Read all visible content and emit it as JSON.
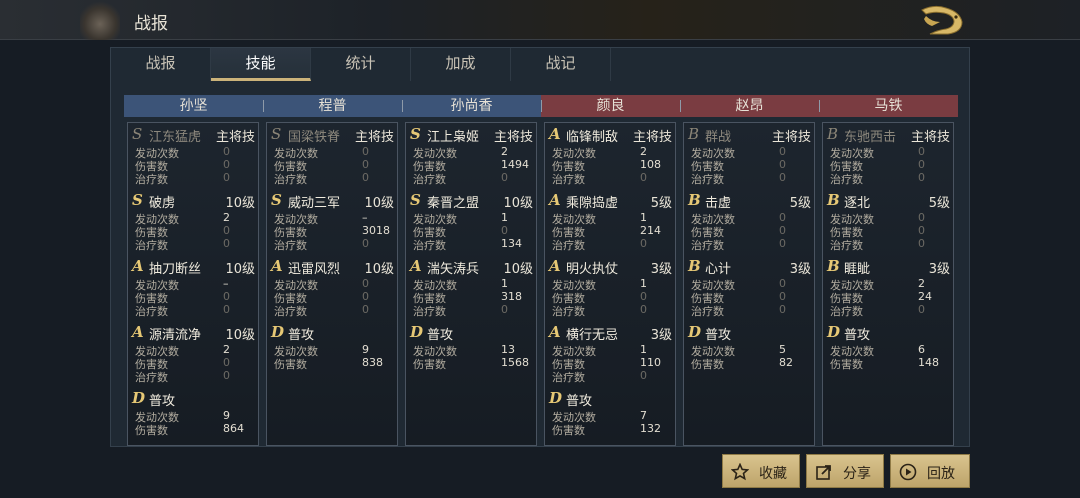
{
  "window": {
    "title": "战报"
  },
  "tabs": [
    {
      "label": "战报",
      "active": false
    },
    {
      "label": "技能",
      "active": true
    },
    {
      "label": "统计",
      "active": false
    },
    {
      "label": "加成",
      "active": false
    },
    {
      "label": "战记",
      "active": false
    }
  ],
  "colors": {
    "ally_header": "#3c5478",
    "enemy_header": "#7a3c41",
    "accent_gold": "#cbb37a",
    "grade_gold": "#e6c875"
  },
  "generals": [
    {
      "name": "孙坚",
      "side": "ally",
      "skills": [
        {
          "grade": "S",
          "name": "江东猛虎",
          "level": "主将技",
          "dim": true,
          "stats": [
            {
              "label": "发动次数",
              "value": "0"
            },
            {
              "label": "伤害数",
              "value": "0"
            },
            {
              "label": "治疗数",
              "value": "0"
            }
          ]
        },
        {
          "grade": "S",
          "name": "破虏",
          "level": "10级",
          "dim": false,
          "stats": [
            {
              "label": "发动次数",
              "value": "2"
            },
            {
              "label": "伤害数",
              "value": "0"
            },
            {
              "label": "治疗数",
              "value": "0"
            }
          ]
        },
        {
          "grade": "A",
          "name": "抽刀断丝",
          "level": "10级",
          "dim": false,
          "stats": [
            {
              "label": "发动次数",
              "value": "–"
            },
            {
              "label": "伤害数",
              "value": "0"
            },
            {
              "label": "治疗数",
              "value": "0"
            }
          ]
        },
        {
          "grade": "A",
          "name": "源清流净",
          "level": "10级",
          "dim": false,
          "stats": [
            {
              "label": "发动次数",
              "value": "2"
            },
            {
              "label": "伤害数",
              "value": "0"
            },
            {
              "label": "治疗数",
              "value": "0"
            }
          ]
        },
        {
          "grade": "D",
          "name": "普攻",
          "level": "",
          "dim": false,
          "stats": [
            {
              "label": "发动次数",
              "value": "9"
            },
            {
              "label": "伤害数",
              "value": "864"
            }
          ]
        }
      ]
    },
    {
      "name": "程普",
      "side": "ally",
      "skills": [
        {
          "grade": "S",
          "name": "国梁铁脊",
          "level": "主将技",
          "dim": true,
          "stats": [
            {
              "label": "发动次数",
              "value": "0"
            },
            {
              "label": "伤害数",
              "value": "0"
            },
            {
              "label": "治疗数",
              "value": "0"
            }
          ]
        },
        {
          "grade": "S",
          "name": "威动三军",
          "level": "10级",
          "dim": false,
          "stats": [
            {
              "label": "发动次数",
              "value": "–"
            },
            {
              "label": "伤害数",
              "value": "3018"
            },
            {
              "label": "治疗数",
              "value": "0"
            }
          ]
        },
        {
          "grade": "A",
          "name": "迅雷风烈",
          "level": "10级",
          "dim": false,
          "stats": [
            {
              "label": "发动次数",
              "value": "0"
            },
            {
              "label": "伤害数",
              "value": "0"
            },
            {
              "label": "治疗数",
              "value": "0"
            }
          ]
        },
        {
          "grade": "D",
          "name": "普攻",
          "level": "",
          "dim": false,
          "stats": [
            {
              "label": "发动次数",
              "value": "9"
            },
            {
              "label": "伤害数",
              "value": "838"
            }
          ]
        }
      ]
    },
    {
      "name": "孙尚香",
      "side": "ally",
      "skills": [
        {
          "grade": "S",
          "name": "江上枭姬",
          "level": "主将技",
          "dim": false,
          "stats": [
            {
              "label": "发动次数",
              "value": "2"
            },
            {
              "label": "伤害数",
              "value": "1494"
            },
            {
              "label": "治疗数",
              "value": "0"
            }
          ]
        },
        {
          "grade": "S",
          "name": "秦晋之盟",
          "level": "10级",
          "dim": false,
          "stats": [
            {
              "label": "发动次数",
              "value": "1"
            },
            {
              "label": "伤害数",
              "value": "0"
            },
            {
              "label": "治疗数",
              "value": "134"
            }
          ]
        },
        {
          "grade": "A",
          "name": "湍矢涛兵",
          "level": "10级",
          "dim": false,
          "stats": [
            {
              "label": "发动次数",
              "value": "1"
            },
            {
              "label": "伤害数",
              "value": "318"
            },
            {
              "label": "治疗数",
              "value": "0"
            }
          ]
        },
        {
          "grade": "D",
          "name": "普攻",
          "level": "",
          "dim": false,
          "stats": [
            {
              "label": "发动次数",
              "value": "13"
            },
            {
              "label": "伤害数",
              "value": "1568"
            }
          ]
        }
      ]
    },
    {
      "name": "颜良",
      "side": "enemy",
      "skills": [
        {
          "grade": "A",
          "name": "临锋制敌",
          "level": "主将技",
          "dim": false,
          "stats": [
            {
              "label": "发动次数",
              "value": "2"
            },
            {
              "label": "伤害数",
              "value": "108"
            },
            {
              "label": "治疗数",
              "value": "0"
            }
          ]
        },
        {
          "grade": "A",
          "name": "乘隙捣虚",
          "level": "5级",
          "dim": false,
          "stats": [
            {
              "label": "发动次数",
              "value": "1"
            },
            {
              "label": "伤害数",
              "value": "214"
            },
            {
              "label": "治疗数",
              "value": "0"
            }
          ]
        },
        {
          "grade": "A",
          "name": "明火执仗",
          "level": "3级",
          "dim": false,
          "stats": [
            {
              "label": "发动次数",
              "value": "1"
            },
            {
              "label": "伤害数",
              "value": "0"
            },
            {
              "label": "治疗数",
              "value": "0"
            }
          ]
        },
        {
          "grade": "A",
          "name": "横行无忌",
          "level": "3级",
          "dim": false,
          "stats": [
            {
              "label": "发动次数",
              "value": "1"
            },
            {
              "label": "伤害数",
              "value": "110"
            },
            {
              "label": "治疗数",
              "value": "0"
            }
          ]
        },
        {
          "grade": "D",
          "name": "普攻",
          "level": "",
          "dim": false,
          "stats": [
            {
              "label": "发动次数",
              "value": "7"
            },
            {
              "label": "伤害数",
              "value": "132"
            }
          ]
        }
      ]
    },
    {
      "name": "赵昂",
      "side": "enemy",
      "skills": [
        {
          "grade": "B",
          "name": "群战",
          "level": "主将技",
          "dim": true,
          "stats": [
            {
              "label": "发动次数",
              "value": "0"
            },
            {
              "label": "伤害数",
              "value": "0"
            },
            {
              "label": "治疗数",
              "value": "0"
            }
          ]
        },
        {
          "grade": "B",
          "name": "击虚",
          "level": "5级",
          "dim": false,
          "stats": [
            {
              "label": "发动次数",
              "value": "0"
            },
            {
              "label": "伤害数",
              "value": "0"
            },
            {
              "label": "治疗数",
              "value": "0"
            }
          ]
        },
        {
          "grade": "B",
          "name": "心计",
          "level": "3级",
          "dim": false,
          "stats": [
            {
              "label": "发动次数",
              "value": "0"
            },
            {
              "label": "伤害数",
              "value": "0"
            },
            {
              "label": "治疗数",
              "value": "0"
            }
          ]
        },
        {
          "grade": "D",
          "name": "普攻",
          "level": "",
          "dim": false,
          "stats": [
            {
              "label": "发动次数",
              "value": "5"
            },
            {
              "label": "伤害数",
              "value": "82"
            }
          ]
        }
      ]
    },
    {
      "name": "马铁",
      "side": "enemy",
      "skills": [
        {
          "grade": "B",
          "name": "东驰西击",
          "level": "主将技",
          "dim": true,
          "stats": [
            {
              "label": "发动次数",
              "value": "0"
            },
            {
              "label": "伤害数",
              "value": "0"
            },
            {
              "label": "治疗数",
              "value": "0"
            }
          ]
        },
        {
          "grade": "B",
          "name": "逐北",
          "level": "5级",
          "dim": false,
          "stats": [
            {
              "label": "发动次数",
              "value": "0"
            },
            {
              "label": "伤害数",
              "value": "0"
            },
            {
              "label": "治疗数",
              "value": "0"
            }
          ]
        },
        {
          "grade": "B",
          "name": "睚眦",
          "level": "3级",
          "dim": false,
          "stats": [
            {
              "label": "发动次数",
              "value": "2"
            },
            {
              "label": "伤害数",
              "value": "24"
            },
            {
              "label": "治疗数",
              "value": "0"
            }
          ]
        },
        {
          "grade": "D",
          "name": "普攻",
          "level": "",
          "dim": false,
          "stats": [
            {
              "label": "发动次数",
              "value": "6"
            },
            {
              "label": "伤害数",
              "value": "148"
            }
          ]
        }
      ]
    }
  ],
  "buttons": [
    {
      "label": "收藏",
      "icon": "star-icon"
    },
    {
      "label": "分享",
      "icon": "share-icon"
    },
    {
      "label": "回放",
      "icon": "play-icon"
    }
  ]
}
